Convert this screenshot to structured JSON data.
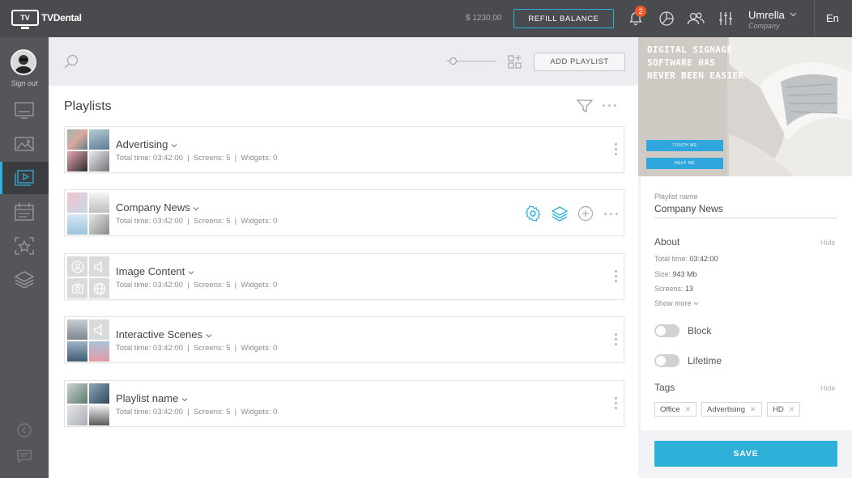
{
  "header": {
    "logo_text": "TVDental",
    "logo_mark": "TV",
    "balance": "$ 1230,00",
    "refill_label": "REFILL BALANCE",
    "notifications_count": "2",
    "user_name": "Umrella",
    "user_sub": "Company",
    "language": "En"
  },
  "sidebar": {
    "signout_label": "Sign out",
    "items": [
      {
        "icon": "screens-icon"
      },
      {
        "icon": "media-icon"
      },
      {
        "icon": "playlists-icon",
        "active": true
      },
      {
        "icon": "schedule-icon"
      },
      {
        "icon": "widgets-icon"
      },
      {
        "icon": "layers-icon"
      }
    ]
  },
  "toolbar": {
    "add_playlist_label": "ADD PLAYLIST"
  },
  "main": {
    "title": "Playlists",
    "playlists": [
      {
        "name": "Advertising",
        "meta": "Total time: 03:42:00  |  Screens: 5  |  Widgets: 0"
      },
      {
        "name": "Company News",
        "meta": "Total time: 03:42:00  |  Screens: 5  |  Widgets: 0"
      },
      {
        "name": "Image Content",
        "meta": "Total time: 03:42:00  |  Screens: 5  |  Widgets: 0"
      },
      {
        "name": "Interactive Scenes",
        "meta": "Total time: 03:42:00  |  Screens: 5  |  Widgets: 0"
      },
      {
        "name": "Playlist name",
        "meta": "Total time: 03:42:00  |  Screens: 5  |  Widgets: 0"
      }
    ]
  },
  "details": {
    "hero_text_1": "DIGITAL SIGNAGE",
    "hero_text_2": "SOFTWARE HAS",
    "hero_text_3": "NEVER BEEN EASIER",
    "hero_btn_1": "TOUCH ME",
    "hero_btn_2": "HELP ME",
    "playlist_name_label": "Playlist name",
    "playlist_name_value": "Company News",
    "about_title": "About",
    "hide_label": "Hide",
    "total_time_label": "Total time:",
    "total_time_value": "03:42:00",
    "size_label": "Size:",
    "size_value": "943 Mb",
    "screens_label": "Screens:",
    "screens_value": "13",
    "show_more": "Show more",
    "block_label": "Block",
    "lifetime_label": "Lifetime",
    "tags_title": "Tags",
    "tags": [
      "Office",
      "Advertising",
      "HD"
    ],
    "save_label": "SAVE"
  },
  "colors": {
    "header_bg": "#4a4b4e",
    "sidebar_bg": "#55565a",
    "accent": "#2fb0d8",
    "badge": "#f05a28"
  }
}
